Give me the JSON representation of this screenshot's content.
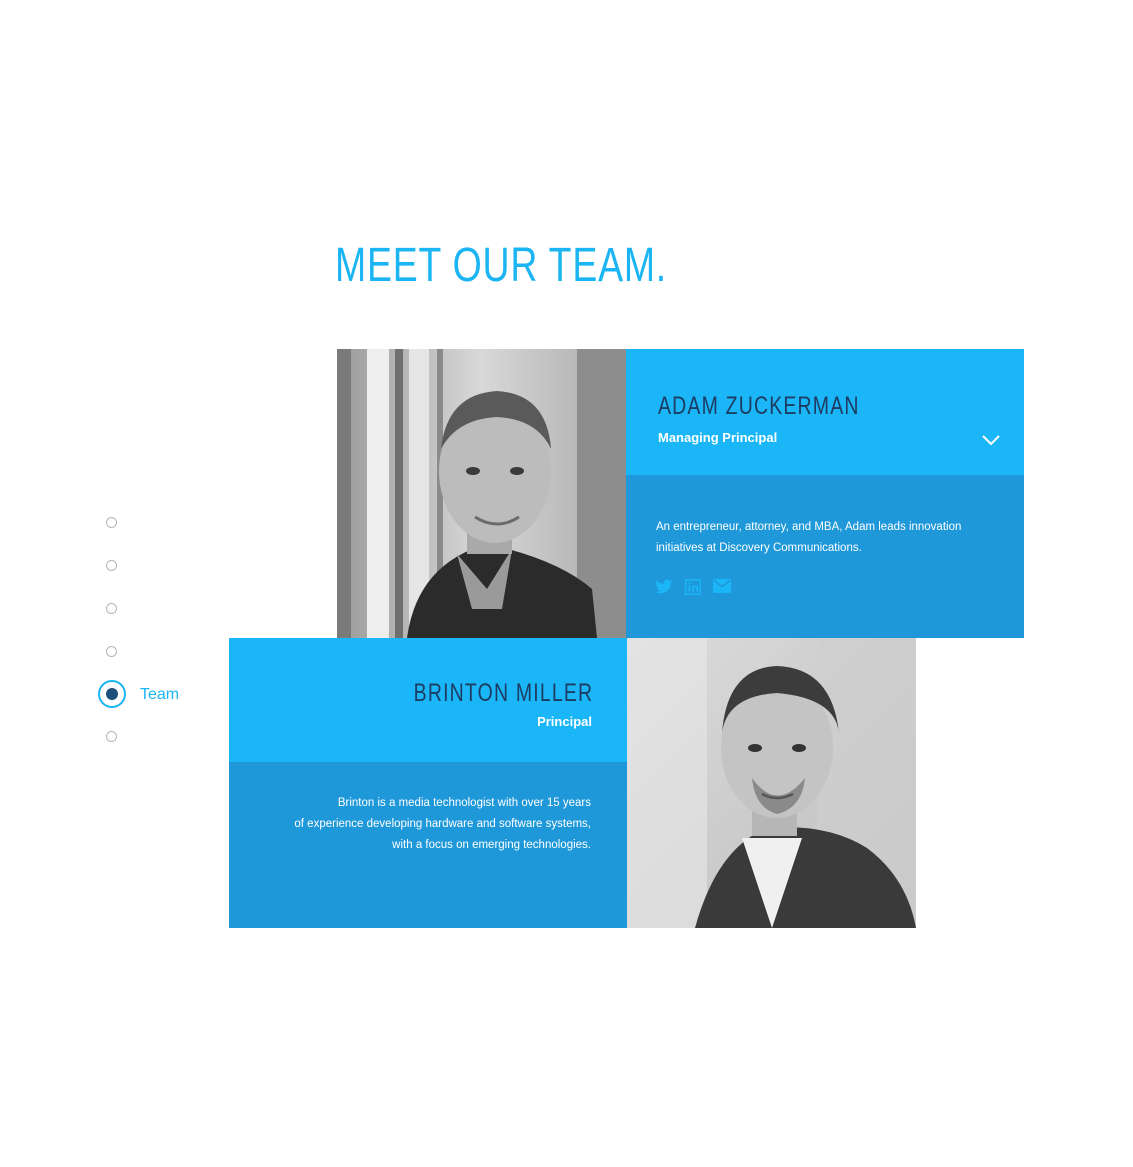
{
  "page": {
    "title": "MEET OUR TEAM."
  },
  "side_nav": {
    "items": [
      "",
      "",
      "",
      "",
      "Team",
      ""
    ],
    "active_index": 4,
    "active_label": "Team"
  },
  "team": [
    {
      "name": "ADAM ZUCKERMAN",
      "role": "Managing Principal",
      "bio_lines": [
        "An entrepreneur, attorney, and MBA, Adam leads innovation",
        "initiatives at Discovery Communications."
      ],
      "social": [
        "twitter-icon",
        "linkedin-icon",
        "email-icon"
      ],
      "expanded": true
    },
    {
      "name": "BRINTON MILLER",
      "role": "Principal",
      "bio_lines": [
        "Brinton is a media technologist with over 15 years",
        "of experience developing hardware and software systems,",
        "with a focus on emerging technologies."
      ]
    }
  ],
  "colors": {
    "accent": "#1ab5f2",
    "card_header": "#1ab6f7",
    "card_body": "#1e98d9",
    "name_text": "#1d3c63",
    "active_dot": "#1d4f7c"
  }
}
